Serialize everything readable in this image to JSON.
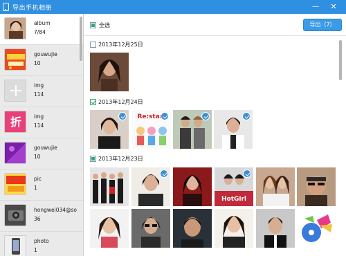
{
  "window": {
    "title": "导出手机相册",
    "minimize_glyph": "—",
    "close_glyph": "✕"
  },
  "sidebar": {
    "items": [
      {
        "name": "album",
        "count": "7/84",
        "icon": "portrait-thumbnail",
        "active": true
      },
      {
        "name": "gouwujie",
        "count": "10",
        "icon": "promo-banner-thumbnail",
        "active": false
      },
      {
        "name": "img",
        "count": "114",
        "icon": "plus-placeholder-thumbnail",
        "active": false
      },
      {
        "name": "img",
        "count": "114",
        "icon": "discount-tag-thumbnail",
        "active": false
      },
      {
        "name": "gouwujie",
        "count": "10",
        "icon": "purple-banner-thumbnail",
        "active": false
      },
      {
        "name": "pic",
        "count": "1",
        "icon": "coupon-thumbnail",
        "active": false
      },
      {
        "name": "hongwei034@so...",
        "count": "36",
        "icon": "camera-thumbnail",
        "active": false
      },
      {
        "name": "photo",
        "count": "1",
        "icon": "phone-thumbnail",
        "active": false
      }
    ]
  },
  "toolbar": {
    "select_all_label": "全选",
    "export_label": "导出（7）"
  },
  "groups": [
    {
      "date": "2013年12月25日",
      "state": "unchecked",
      "photos": [
        {
          "checked": false
        }
      ]
    },
    {
      "date": "2013年12月24日",
      "state": "checked",
      "photos": [
        {
          "checked": true
        },
        {
          "checked": true
        },
        {
          "checked": true
        },
        {
          "checked": true
        }
      ]
    },
    {
      "date": "2013年12月23日",
      "state": "partial",
      "photos": [
        {
          "checked": false
        },
        {
          "checked": true
        },
        {
          "checked": false
        },
        {
          "checked": true
        },
        {
          "checked": false
        },
        {
          "checked": false
        },
        {
          "checked": false
        },
        {
          "checked": false
        },
        {
          "checked": false
        },
        {
          "checked": false
        },
        {
          "checked": false
        }
      ]
    }
  ],
  "colors": {
    "accent": "#2f8fe0",
    "check_badge": "#3b8fd8",
    "group_check": "#3aa56a"
  }
}
